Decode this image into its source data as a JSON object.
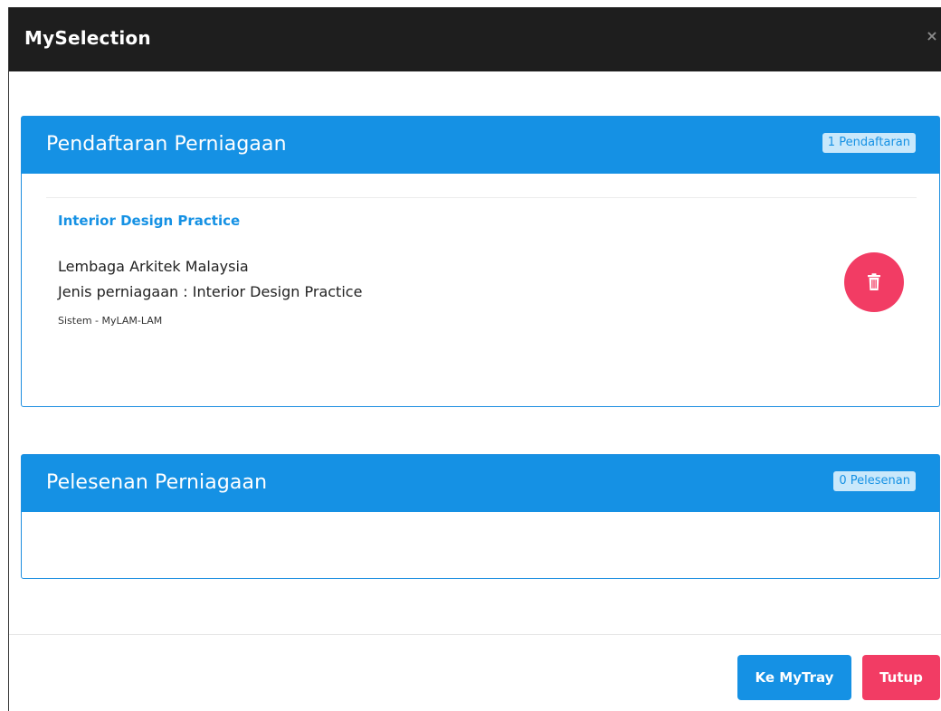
{
  "modal": {
    "title": "MySelection",
    "close_label": "×"
  },
  "pendaftaran": {
    "title": "Pendaftaran Perniagaan",
    "badge": "1 Pendaftaran",
    "items": [
      {
        "title": "Interior Design Practice",
        "organization": "Lembaga Arkitek Malaysia",
        "business_type": "Jenis perniagaan : Interior Design Practice",
        "system": "Sistem - MyLAM-LAM"
      }
    ]
  },
  "pelesenan": {
    "title": "Pelesenan Perniagaan",
    "badge": "0 Pelesenan"
  },
  "footer": {
    "mytray_label": "Ke MyTray",
    "close_label": "Tutup"
  },
  "colors": {
    "header_bg": "#1e1e1e",
    "panel_blue": "#1591e4",
    "danger_red": "#f23c64",
    "badge_bg": "#c9e8fb"
  },
  "icons": {
    "close": "close-icon",
    "delete": "trash-icon"
  }
}
